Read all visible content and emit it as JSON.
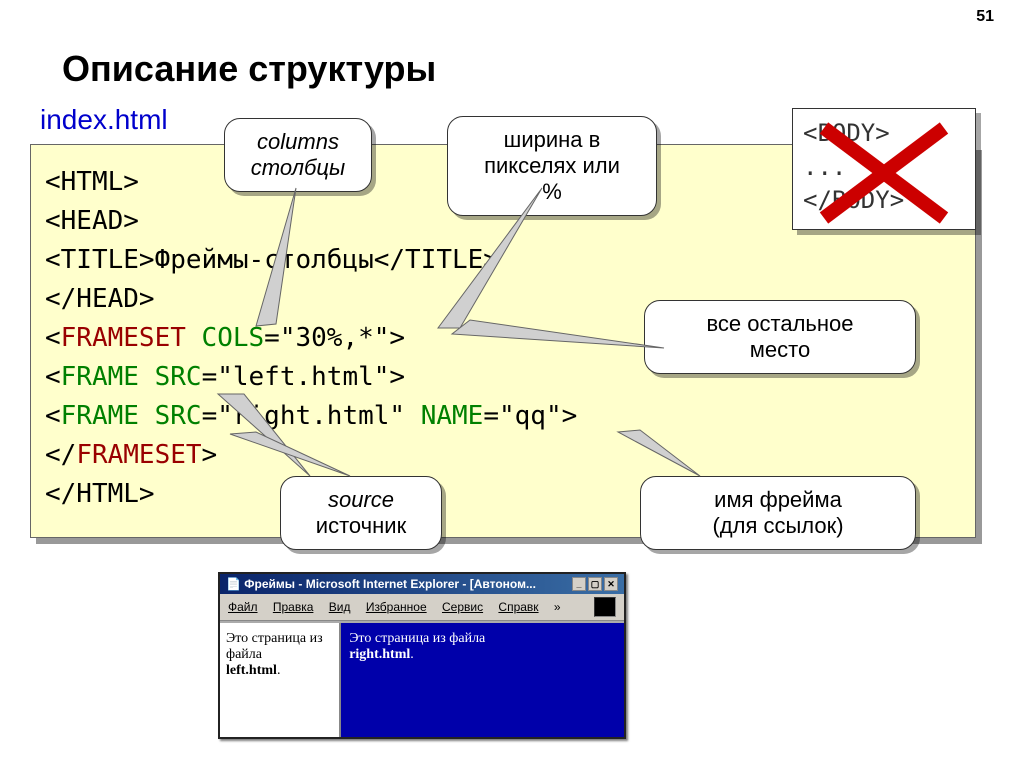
{
  "page_number": "51",
  "title": "Описание структуры",
  "subtitle": "index.html",
  "code": {
    "l1": "<HTML>",
    "l2": "<HEAD>",
    "l3a": "    <TITLE>",
    "l3b": "Фреймы-столбцы",
    "l3c": "</TITLE>",
    "l4": "</HEAD>",
    "l5a": "<",
    "l5b": "FRAMESET",
    "l5c": " ",
    "l5d": "COLS",
    "l5e": "=",
    "l5f": "\"30%,*\"",
    "l5g": ">",
    "l6a": "    <",
    "l6b": "FRAME",
    "l6c": " ",
    "l6d": "SRC",
    "l6e": "=",
    "l6f": "\"left.html\"",
    "l6g": ">",
    "l7a": "    <",
    "l7b": "FRAME",
    "l7c": " ",
    "l7d": "SRC",
    "l7e": "=",
    "l7f": "\"right.html\"",
    "l7g": " ",
    "l7h": "NAME",
    "l7i": "=",
    "l7j": "\"qq\"",
    "l7k": ">",
    "l8a": "</",
    "l8b": "FRAMESET",
    "l8c": ">",
    "l9": "</HTML>"
  },
  "callouts": {
    "columns_l1": "columns",
    "columns_l2": "столбцы",
    "width_l1": "ширина в",
    "width_l2": "пикселях или %",
    "rest_l1": "все остальное",
    "rest_l2": "место",
    "source_l1": "source",
    "source_l2": "источник",
    "name_l1": "имя фрейма",
    "name_l2": "(для ссылок)"
  },
  "body_box": {
    "l1": "<BODY>",
    "l2": "...",
    "l3": "</BODY>"
  },
  "browser": {
    "title": "Фреймы - Microsoft Internet Explorer - [Автоном...",
    "menu": {
      "file": "Файл",
      "edit": "Правка",
      "view": "Вид",
      "fav": "Избранное",
      "tools": "Сервис",
      "help": "Справк"
    },
    "left_text": "Это страница из файла",
    "left_bold": "left.html",
    "right_text": "Это страница из файла",
    "right_bold": "right.html"
  }
}
